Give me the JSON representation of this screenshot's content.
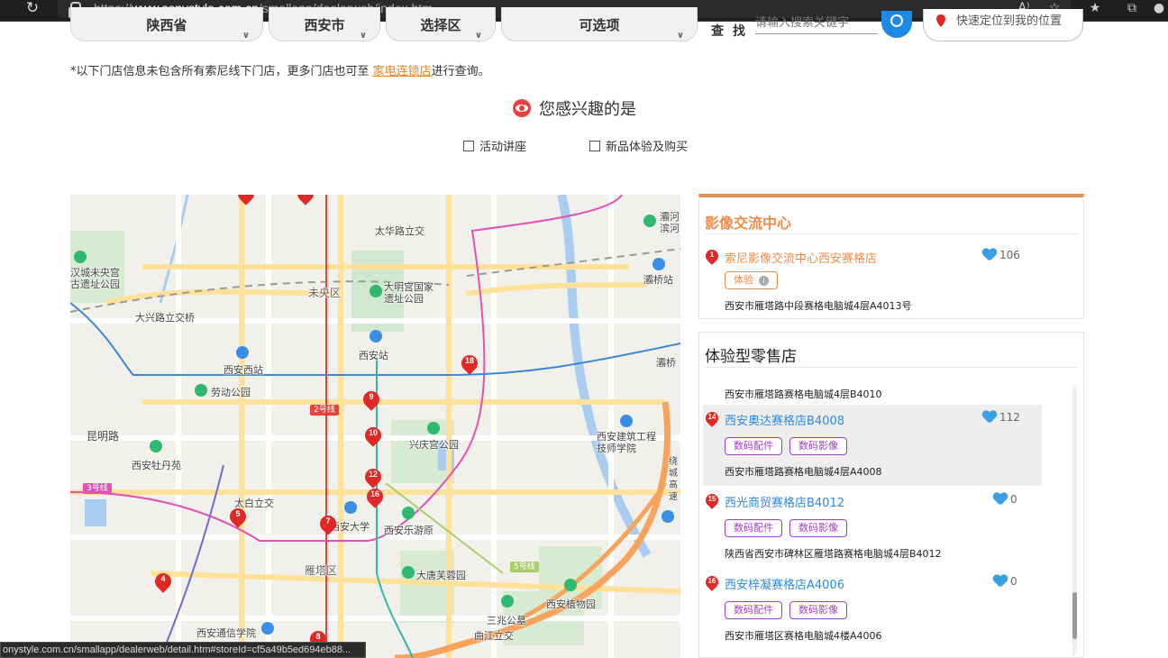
{
  "browser": {
    "url_prefix": "https://",
    "url_domain": "www.sonystyle.com.cn",
    "url_path": "/smallapp/dealerweb/index.htm",
    "status_url": "onystyle.com.cn/smallapp/dealerweb/detail.htm#storeId=cf5a49b5ed694eb88..."
  },
  "filters": {
    "province": "陕西省",
    "city": "西安市",
    "district": "选择区",
    "optional": "可选项",
    "search_label": "查找",
    "search_placeholder": "请输入搜索关键字",
    "locate_label": "快速定位到我的位置"
  },
  "notice": {
    "text_before": "*以下门店信息未包含所有索尼线下门店，更多门店也可至 ",
    "link": "家电连锁店",
    "text_after": "进行查询。"
  },
  "interest": {
    "title": "您感兴趣的是",
    "options": [
      "活动讲座",
      "新品体验及购买"
    ]
  },
  "map": {
    "labels": {
      "taihua": "太华路立交",
      "weiyang": "未央区",
      "daming": "大明宫国家遗址公园",
      "xian_old": "汉城未央宫古遗址公园",
      "daxing": "大兴路立交桥",
      "xian_west": "西安西站",
      "xian_station": "西安站",
      "laodong": "劳动公园",
      "kunming": "昆明路",
      "xian_peony": "西安牡丹苑",
      "xingqing": "兴庆宫公园",
      "xajz": "西安建筑工程技师学院",
      "taibai": "太白立交",
      "xjtu": "西安大学",
      "xian_amuse": "西安乐游原",
      "yanta": "雁塔区",
      "furong": "大唐芙蓉园",
      "botanic": "西安植物园",
      "sanzhao": "三兆公墓",
      "qujiang": "曲江立交",
      "telecom": "西安通信学院",
      "bahe": "灞桥站",
      "baqiao": "灞桥",
      "chanhe": "灞河滨河",
      "ring": "绕城高速",
      "line2": "2号线",
      "line3": "3号线",
      "line5": "5号线"
    },
    "markers": [
      "18",
      "9",
      "10",
      "12",
      "16",
      "7",
      "5",
      "4",
      "8"
    ]
  },
  "panel_imaging": {
    "title": "影像交流中心",
    "store": {
      "num": "1",
      "name": "索尼影像交流中心西安赛格店",
      "likes": "106",
      "tag": "体验",
      "address": "西安市雁塔路中段赛格电脑城4层A4013号"
    }
  },
  "panel_retail": {
    "title": "体验型零售店",
    "prev_address": "西安市雁塔路赛格电脑城4层B4010",
    "stores": [
      {
        "num": "14",
        "name": "西安奥达赛格店B4008",
        "likes": "112",
        "tags": [
          "数码配件",
          "数码影像"
        ],
        "address": "西安市雁塔路赛格电脑城4层A4008"
      },
      {
        "num": "15",
        "name": "西光商贸赛格店B4012",
        "likes": "0",
        "tags": [
          "数码配件",
          "数码影像"
        ],
        "address": "陕西省西安市碑林区雁塔路赛格电脑城4层B4012"
      },
      {
        "num": "16",
        "name": "西安梓凝赛格店A4006",
        "likes": "0",
        "tags": [
          "数码配件",
          "数码影像"
        ],
        "address": "西安市雁塔区赛格电脑城4楼A4006"
      }
    ]
  },
  "colors": {
    "accent_orange": "#f08c4a",
    "link_blue": "#2f8ae0",
    "marker_red": "#e02826",
    "tag_purple": "#a040c8"
  }
}
